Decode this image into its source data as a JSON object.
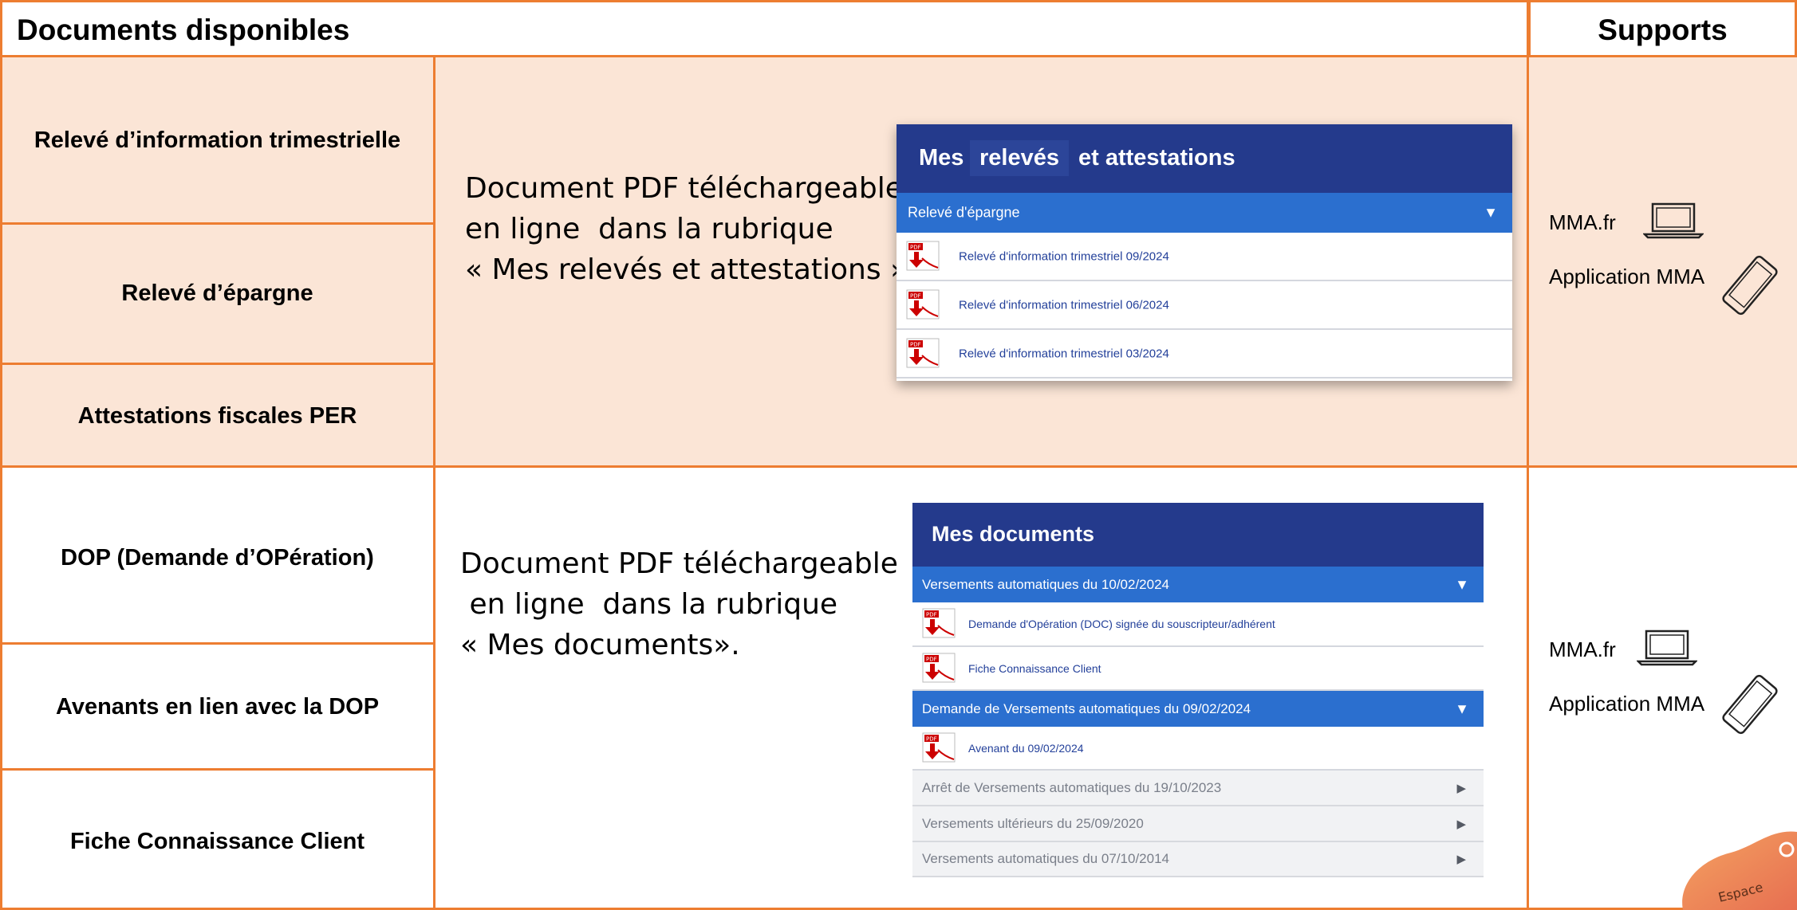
{
  "header": {
    "documents_title": "Documents disponibles",
    "supports_title": "Supports"
  },
  "section1": {
    "documents": [
      "Relevé d’information trimestrielle",
      "Relevé d’épargne",
      "Attestations fiscales PER"
    ],
    "description_lines": [
      "Document PDF téléchargeable",
      "en ligne  dans la rubrique",
      "« Mes relevés et attestations »."
    ],
    "screenshot": {
      "title_prefix": "Mes",
      "title_highlight": "relevés",
      "title_suffix": "et attestations",
      "dropdown_label": "Relevé d'épargne",
      "files": [
        "Relevé d'information trimestriel 09/2024",
        "Relevé d'information trimestriel 06/2024",
        "Relevé d'information trimestriel 03/2024"
      ]
    },
    "supports": {
      "web_label": "MMA.fr",
      "app_label": "Application MMA"
    }
  },
  "section2": {
    "documents": [
      "DOP (Demande d’OPération)",
      "Avenants en lien avec la DOP",
      "Fiche Connaissance Client"
    ],
    "description_lines": [
      "Document PDF téléchargeable",
      " en ligne  dans la rubrique",
      "« Mes documents»."
    ],
    "screenshot": {
      "title": "Mes documents",
      "group1_label": "Versements automatiques du 10/02/2024",
      "group1_files": [
        "Demande d'Opération (DOC) signée du souscripteur/adhérent",
        "Fiche Connaissance Client"
      ],
      "group2_label": "Demande de Versements automatiques du 09/02/2024",
      "group2_files": [
        "Avenant du 09/02/2024"
      ],
      "collapsed_groups": [
        "Arrêt de Versements automatiques du 19/10/2023",
        "Versements ultérieurs du 25/09/2020",
        "Versements automatiques du 07/10/2014"
      ]
    },
    "supports": {
      "web_label": "MMA.fr",
      "app_label": "Application MMA"
    }
  },
  "pdf_icon_label": "PDF",
  "badge": {
    "text": "Espace"
  },
  "colors": {
    "accent_orange": "#ed7d31",
    "band_peach": "#fbe5d6",
    "header_navy": "#243a8c",
    "bar_blue": "#2b6fcf",
    "link_blue": "#23409a"
  }
}
